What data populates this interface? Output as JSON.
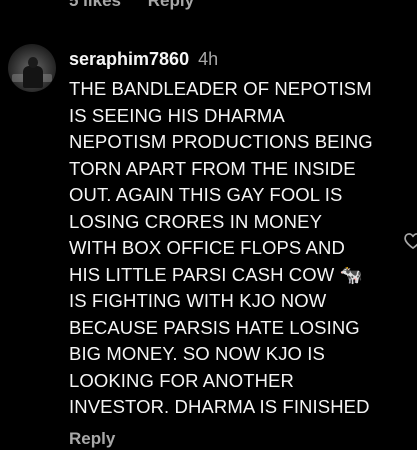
{
  "previous_comment": {
    "likes_label": "5 likes",
    "reply_label": "Reply"
  },
  "comment": {
    "username": "seraphim7860",
    "timestamp": "4h",
    "text": "THE BANDLEADER OF NEPOTISM\nIS SEEING HIS DHARMA\nNEPOTISM PRODUCTIONS BEING\nTORN APART FROM THE INSIDE\nOUT. AGAIN THIS GAY FOOL IS\nLOSING CRORES IN MONEY\nWITH BOX OFFICE FLOPS AND\nHIS LITTLE PARSI CASH COW 🐄\nIS FIGHTING WITH KJO NOW\nBECAUSE PARSIS HATE LOSING\nBIG MONEY. SO NOW KJO IS\nLOOKING FOR ANOTHER\nINVESTOR. DHARMA IS FINISHED",
    "reply_label": "Reply",
    "like_icon": "heart-outline"
  },
  "colors": {
    "background": "#000000",
    "primary_text": "#f5f5f5",
    "secondary_text": "#a8a8a8"
  }
}
